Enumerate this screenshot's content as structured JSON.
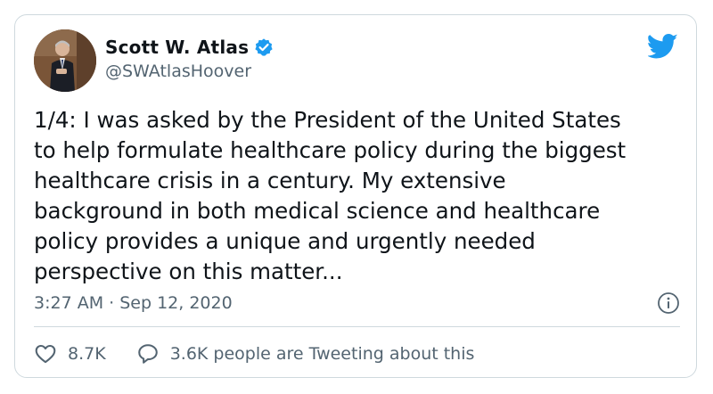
{
  "author": {
    "name": "Scott W. Atlas",
    "handle": "@SWAtlasHoover",
    "verified": true
  },
  "tweet": {
    "text": "1/4: I was asked by the President of the United States\nto help formulate healthcare policy during the biggest\nhealthcare crisis in a century. My extensive\nbackground in both medical science and healthcare\npolicy provides a unique and urgently needed\nperspective on this matter...",
    "timestamp": "3:27 AM · Sep 12, 2020"
  },
  "actions": {
    "likes": "8.7K",
    "conversation": "3.6K people are Tweeting about this"
  },
  "icons": {
    "brand": "twitter-bird-icon",
    "verified": "verified-badge-icon",
    "info": "info-icon",
    "like": "heart-icon",
    "reply": "speech-bubble-icon"
  },
  "colors": {
    "brand": "#1d9bf0",
    "text": "#0f1419",
    "secondary": "#536471",
    "border": "#cfd9de"
  }
}
